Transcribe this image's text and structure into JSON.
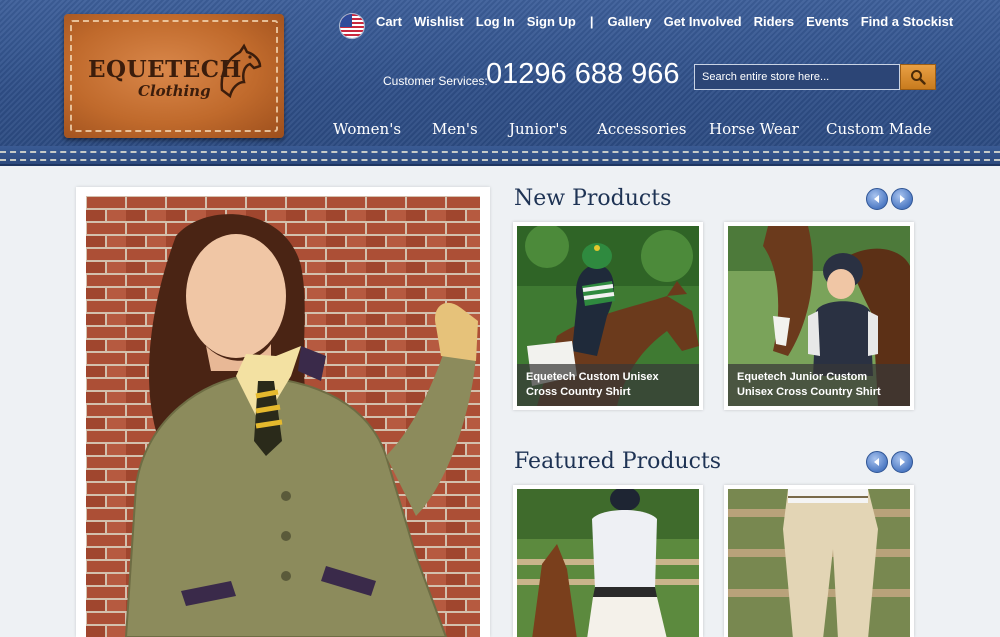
{
  "brand": {
    "name": "EQUETECH",
    "sub": "Clothing"
  },
  "topnav": {
    "left": [
      "Cart",
      "Wishlist",
      "Log In",
      "Sign Up"
    ],
    "separator": "|",
    "right": [
      "Gallery",
      "Get Involved",
      "Riders",
      "Events",
      "Find a Stockist"
    ]
  },
  "customer_services": {
    "label": "Customer Services:",
    "phone": "01296 688 966"
  },
  "search": {
    "placeholder": "Search entire store here..."
  },
  "mainnav": [
    "Women's",
    "Men's",
    "Junior's",
    "Accessories",
    "Horse Wear",
    "Custom Made"
  ],
  "sections": {
    "new_products": {
      "title": "New Products",
      "items": [
        {
          "caption": "Equetech Custom Unisex Cross Country Shirt"
        },
        {
          "caption": "Equetech Junior Custom Unisex Cross Country Shirt"
        }
      ]
    },
    "featured_products": {
      "title": "Featured Products"
    }
  },
  "icons": {
    "flag": "us-flag-icon",
    "search": "search-icon",
    "prev": "arrow-left-icon",
    "next": "arrow-right-icon"
  },
  "colors": {
    "header_blue": "#2f4f88",
    "title_navy": "#1e3354",
    "search_orange": "#d68a2c",
    "patch_leather": "#c06a2c"
  }
}
